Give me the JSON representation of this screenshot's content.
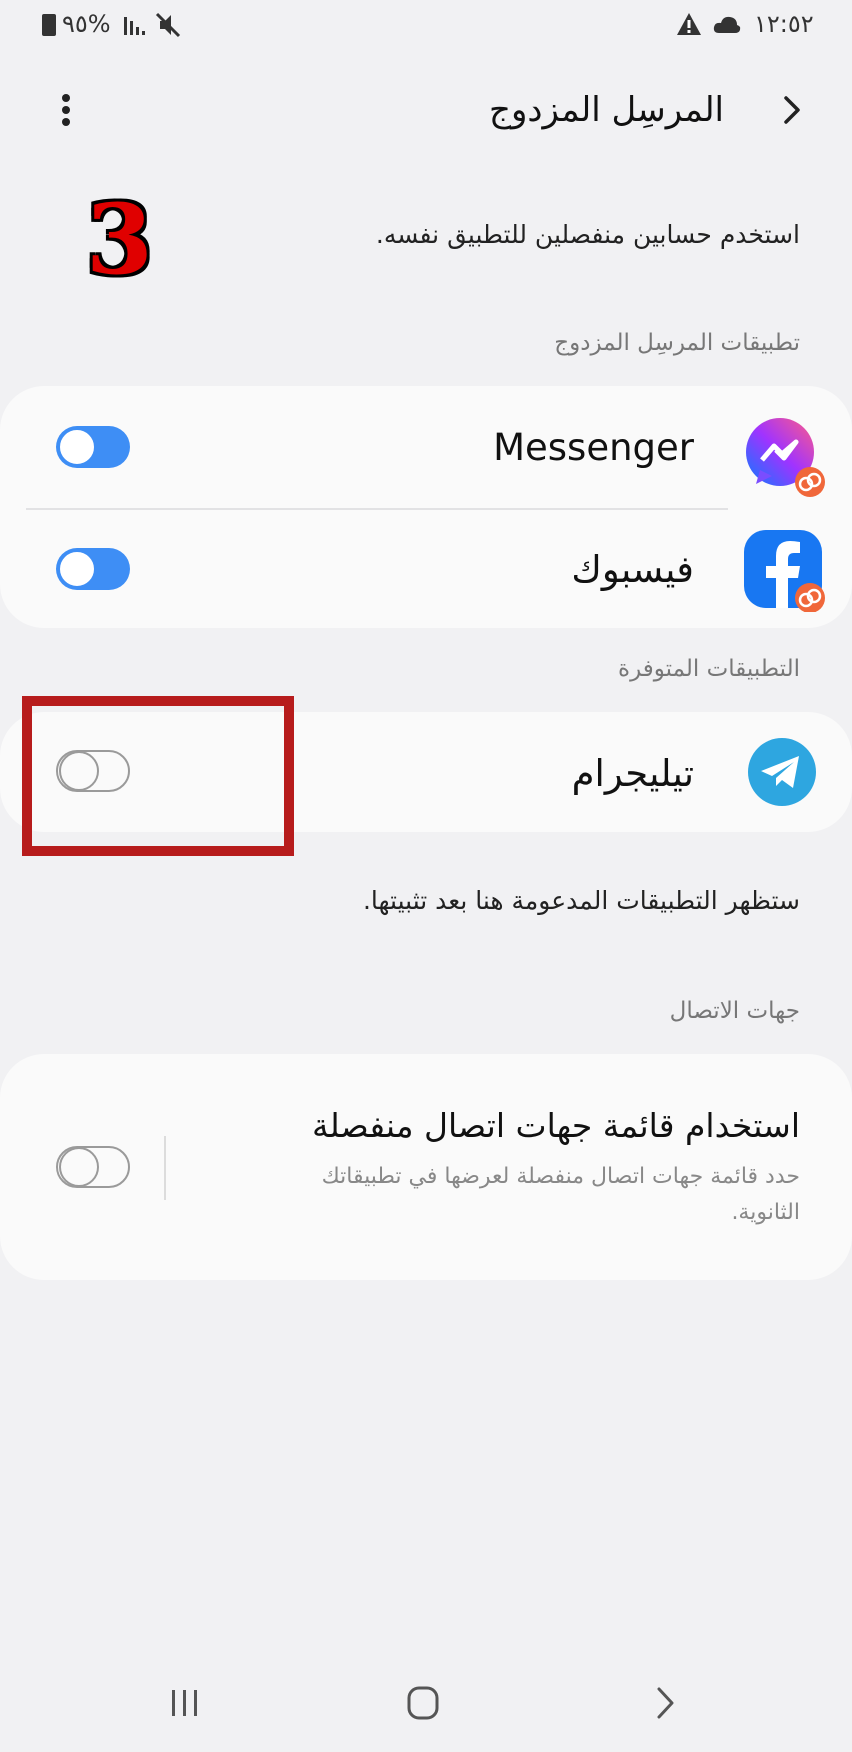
{
  "status_bar": {
    "battery": "%٩٥",
    "time": "١٢:٥٢"
  },
  "header": {
    "title": "المرسِل المزدوج"
  },
  "annotation": {
    "step_number": "3",
    "highlight_color": "#b71c1c"
  },
  "description": "استخدم حسابين منفصلين للتطبيق نفسه.",
  "sections": {
    "dual_apps_label": "تطبيقات المرسِل المزدوج",
    "available_apps_label": "التطبيقات المتوفرة",
    "available_note": "ستظهر التطبيقات المدعومة هنا بعد تثبيتها.",
    "contacts_label": "جهات الاتصال"
  },
  "dual_apps": [
    {
      "name": "Messenger",
      "icon": "messenger-icon",
      "enabled": true
    },
    {
      "name": "فيسبوك",
      "icon": "facebook-icon",
      "enabled": true
    }
  ],
  "available_apps": [
    {
      "name": "تيليجرام",
      "icon": "telegram-icon",
      "enabled": false
    }
  ],
  "contacts_setting": {
    "title": "استخدام قائمة جهات اتصال منفصلة",
    "description_line1": "حدد قائمة جهات اتصال منفصلة لعرضها في تطبيقاتك",
    "description_line2": "الثانوية.",
    "enabled": false
  },
  "colors": {
    "accent": "#3e8ef5",
    "background": "#f1f1f3",
    "card": "#fafafa"
  }
}
